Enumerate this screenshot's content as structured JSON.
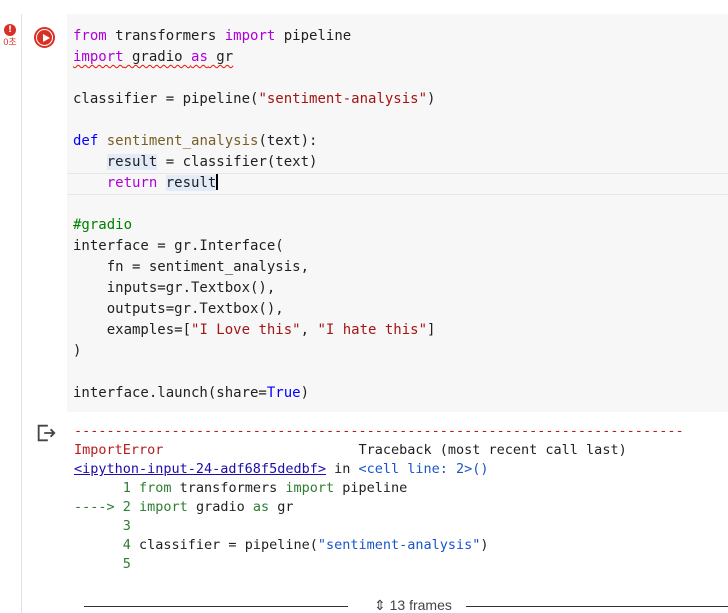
{
  "cell": {
    "exec_count": "0초",
    "error_badge": "!",
    "code_lines": [
      "from transformers import pipeline",
      "import gradio as gr",
      "",
      "classifier = pipeline(\"sentiment-analysis\")",
      "",
      "def sentiment_analysis(text):",
      "    result = classifier(text)",
      "    return result",
      "",
      "#gradio",
      "interface = gr.Interface(",
      "    fn = sentiment_analysis,",
      "    inputs=gr.Textbox(),",
      "    outputs=gr.Textbox(),",
      "    examples=[\"I Love this\", \"I hate this\"]",
      ")",
      "",
      "interface.launch(share=True)"
    ]
  },
  "output": {
    "separator": "---------------------------------------------------------------------------",
    "error_type": "ImportError",
    "traceback_label": "Traceback (most recent call last)",
    "source_link": "<ipython-input-24-adf68f5dedbf>",
    "in_word": " in ",
    "cell_ref": "<cell line: 2>()",
    "trace_lines": [
      {
        "prefix": "      1 ",
        "text": "from transformers import pipeline"
      },
      {
        "prefix": "----> 2 ",
        "text": "import gradio as gr"
      },
      {
        "prefix": "      3",
        "text": ""
      },
      {
        "prefix": "      4 ",
        "text": "classifier = pipeline(\"sentiment-analysis\")"
      },
      {
        "prefix": "      5",
        "text": ""
      }
    ],
    "frames_label": "13 frames"
  },
  "colors": {
    "error": "#d93025",
    "keyword": "#af00db",
    "string": "#a31515"
  }
}
